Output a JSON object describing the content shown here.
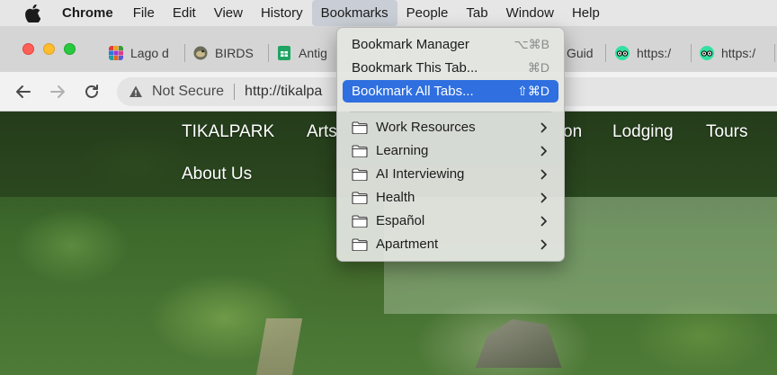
{
  "menubar": {
    "apple_icon": "apple-logo-icon",
    "app_name": "Chrome",
    "items": [
      "File",
      "Edit",
      "View",
      "History",
      "Bookmarks",
      "People",
      "Tab",
      "Window",
      "Help"
    ],
    "active_item": "Bookmarks"
  },
  "tabs": [
    {
      "title": "Lago d",
      "favicon": "grid-favicon"
    },
    {
      "title": "BIRDS",
      "favicon": "bird-favicon"
    },
    {
      "title": "Antig",
      "favicon": "sheets-favicon"
    },
    {
      "title": "Guid",
      "favicon": "generic-favicon"
    },
    {
      "title": "https:/",
      "favicon": "tripadvisor-favicon"
    },
    {
      "title": "https:/",
      "favicon": "tripadvisor-favicon"
    }
  ],
  "toolbar": {
    "security_label": "Not Secure",
    "url": "http://tikalpa"
  },
  "site": {
    "nav": [
      "TIKALPARK",
      "Arts",
      "on",
      "Lodging",
      "Tours",
      "About Us"
    ]
  },
  "bookmarks_menu": {
    "items": [
      {
        "label": "Bookmark Manager",
        "shortcut": "⌥⌘B"
      },
      {
        "label": "Bookmark This Tab...",
        "shortcut": "⌘D"
      },
      {
        "label": "Bookmark All Tabs...",
        "shortcut": "⇧⌘D",
        "selected": true
      }
    ],
    "folders": [
      "Work Resources",
      "Learning",
      "AI Interviewing",
      "Health",
      "Español",
      "Apartment"
    ]
  },
  "colors": {
    "menu_highlight": "#2f6fe0",
    "close": "#ff5f57",
    "minimize": "#febc2e",
    "maximize": "#28c840"
  }
}
